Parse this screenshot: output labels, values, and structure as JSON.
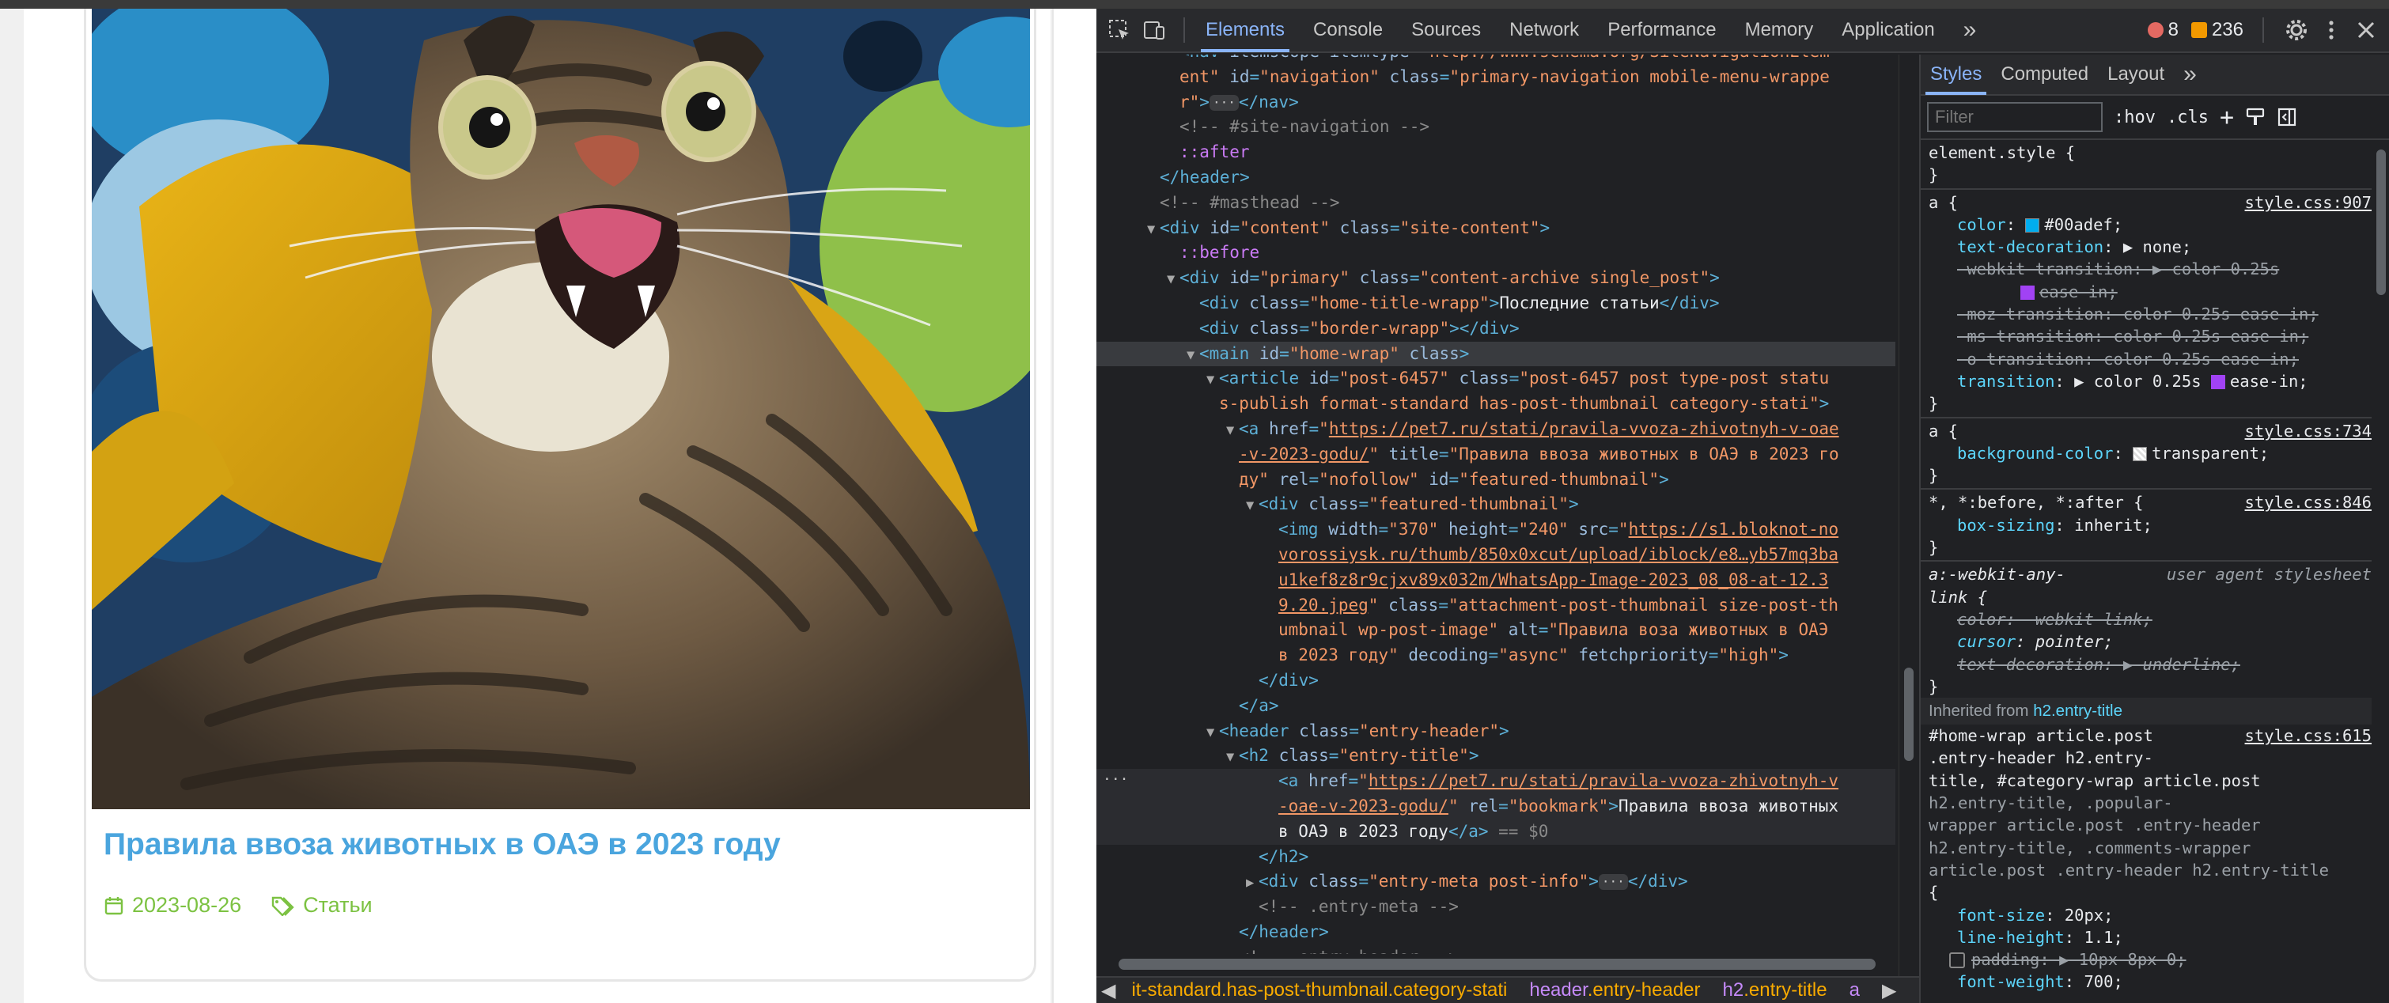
{
  "page": {
    "article_title": "Правила ввоза животных в ОАЭ в 2023 году",
    "date": "2023-08-26",
    "category": "Статьи"
  },
  "devtools": {
    "tabs": [
      "Elements",
      "Console",
      "Sources",
      "Network",
      "Performance",
      "Memory",
      "Application"
    ],
    "more": "»",
    "errors": "8",
    "warnings": "236",
    "styles_tabs": [
      "Styles",
      "Computed",
      "Layout"
    ],
    "filter_placeholder": "Filter",
    "hov": ":hov",
    "cls": ".cls",
    "dom": [
      {
        "i": 3,
        "parts": [
          [
            "tag",
            "<nav "
          ],
          [
            "an",
            "itemscope itemtype"
          ],
          [
            "tag",
            "="
          ],
          [
            "av",
            "\"http://www.schema.org/SiteNavigationElem"
          ]
        ]
      },
      {
        "i": 3,
        "parts": [
          [
            "av",
            "ent\" "
          ],
          [
            "an",
            "id"
          ],
          [
            "tag",
            "="
          ],
          [
            "av",
            "\"navigation\" "
          ],
          [
            "an",
            "class"
          ],
          [
            "tag",
            "="
          ],
          [
            "av",
            "\"primary-navigation mobile-menu-wrappe"
          ]
        ]
      },
      {
        "i": 3,
        "parts": [
          [
            "av",
            "r\""
          ],
          [
            "tag",
            ">"
          ],
          [
            "ell",
            "···"
          ],
          [
            "tag",
            "</nav>"
          ]
        ]
      },
      {
        "i": 3,
        "parts": [
          [
            "cm",
            "<!-- #site-navigation -->"
          ]
        ]
      },
      {
        "i": 3,
        "parts": [
          [
            "pe",
            "::after"
          ]
        ]
      },
      {
        "i": 2,
        "parts": [
          [
            "tag",
            "</header>"
          ]
        ]
      },
      {
        "i": 2,
        "parts": [
          [
            "cm",
            "<!-- #masthead -->"
          ]
        ]
      },
      {
        "i": 2,
        "tri": "▼",
        "parts": [
          [
            "tag",
            "<div "
          ],
          [
            "an",
            "id"
          ],
          [
            "tag",
            "="
          ],
          [
            "av",
            "\"content\" "
          ],
          [
            "an",
            "class"
          ],
          [
            "tag",
            "="
          ],
          [
            "av",
            "\"site-content\""
          ],
          [
            "tag",
            ">"
          ]
        ]
      },
      {
        "i": 3,
        "parts": [
          [
            "pe",
            "::before"
          ]
        ]
      },
      {
        "i": 3,
        "tri": "▼",
        "parts": [
          [
            "tag",
            "<div "
          ],
          [
            "an",
            "id"
          ],
          [
            "tag",
            "="
          ],
          [
            "av",
            "\"primary\" "
          ],
          [
            "an",
            "class"
          ],
          [
            "tag",
            "="
          ],
          [
            "av",
            "\"content-archive single_post\""
          ],
          [
            "tag",
            ">"
          ]
        ]
      },
      {
        "i": 4,
        "parts": [
          [
            "tag",
            "<div "
          ],
          [
            "an",
            "class"
          ],
          [
            "tag",
            "="
          ],
          [
            "av",
            "\"home-title-wrapp\""
          ],
          [
            "tag",
            ">"
          ],
          [
            "tx",
            "Последние статьи"
          ],
          [
            "tag",
            "</div>"
          ]
        ]
      },
      {
        "i": 4,
        "parts": [
          [
            "tag",
            "<div "
          ],
          [
            "an",
            "class"
          ],
          [
            "tag",
            "="
          ],
          [
            "av",
            "\"border-wrapp\""
          ],
          [
            "tag",
            "></div>"
          ]
        ]
      },
      {
        "i": 4,
        "tri": "▼",
        "sel": true,
        "parts": [
          [
            "tag",
            "<main "
          ],
          [
            "an",
            "id"
          ],
          [
            "tag",
            "="
          ],
          [
            "av",
            "\"home-wrap\" "
          ],
          [
            "an",
            "class"
          ],
          [
            "tag",
            ">"
          ]
        ]
      },
      {
        "i": 5,
        "tri": "▼",
        "parts": [
          [
            "tag",
            "<article "
          ],
          [
            "an",
            "id"
          ],
          [
            "tag",
            "="
          ],
          [
            "av",
            "\"post-6457\" "
          ],
          [
            "an",
            "class"
          ],
          [
            "tag",
            "="
          ],
          [
            "av",
            "\"post-6457 post type-post statu"
          ]
        ]
      },
      {
        "i": 5,
        "parts": [
          [
            "av",
            "s-publish format-standard has-post-thumbnail category-stati\""
          ],
          [
            "tag",
            ">"
          ]
        ]
      },
      {
        "i": 6,
        "tri": "▼",
        "parts": [
          [
            "tag",
            "<a "
          ],
          [
            "an",
            "href"
          ],
          [
            "tag",
            "="
          ],
          [
            "av",
            "\""
          ],
          [
            "lk",
            "https://pet7.ru/stati/pravila-vvoza-zhivotnyh-v-oae"
          ]
        ]
      },
      {
        "i": 6,
        "parts": [
          [
            "lk",
            "-v-2023-godu/"
          ],
          [
            "av",
            "\" "
          ],
          [
            "an",
            "title"
          ],
          [
            "tag",
            "="
          ],
          [
            "av",
            "\"Правила ввоза животных в ОАЭ в 2023 го"
          ]
        ]
      },
      {
        "i": 6,
        "parts": [
          [
            "av",
            "ду\" "
          ],
          [
            "an",
            "rel"
          ],
          [
            "tag",
            "="
          ],
          [
            "av",
            "\"nofollow\" "
          ],
          [
            "an",
            "id"
          ],
          [
            "tag",
            "="
          ],
          [
            "av",
            "\"featured-thumbnail\""
          ],
          [
            "tag",
            ">"
          ]
        ]
      },
      {
        "i": 7,
        "tri": "▼",
        "parts": [
          [
            "tag",
            "<div "
          ],
          [
            "an",
            "class"
          ],
          [
            "tag",
            "="
          ],
          [
            "av",
            "\"featured-thumbnail\""
          ],
          [
            "tag",
            ">"
          ]
        ]
      },
      {
        "i": 8,
        "parts": [
          [
            "tag",
            "<img "
          ],
          [
            "an",
            "width"
          ],
          [
            "tag",
            "="
          ],
          [
            "av",
            "\"370\" "
          ],
          [
            "an",
            "height"
          ],
          [
            "tag",
            "="
          ],
          [
            "av",
            "\"240\" "
          ],
          [
            "an",
            "src"
          ],
          [
            "tag",
            "="
          ],
          [
            "av",
            "\""
          ],
          [
            "lk",
            "https://s1.bloknot-no"
          ]
        ]
      },
      {
        "i": 8,
        "parts": [
          [
            "lk",
            "vorossiysk.ru/thumb/850x0xcut/upload/iblock/e8…yb57mq3ba"
          ]
        ]
      },
      {
        "i": 8,
        "parts": [
          [
            "lk",
            "u1kef8z8r9cjxv89x032m/WhatsApp-Image-2023_08_08-at-12.3"
          ]
        ]
      },
      {
        "i": 8,
        "parts": [
          [
            "lk",
            "9.20.jpeg"
          ],
          [
            "av",
            "\" "
          ],
          [
            "an",
            "class"
          ],
          [
            "tag",
            "="
          ],
          [
            "av",
            "\"attachment-post-thumbnail size-post-th"
          ]
        ]
      },
      {
        "i": 8,
        "parts": [
          [
            "av",
            "umbnail wp-post-image\" "
          ],
          [
            "an",
            "alt"
          ],
          [
            "tag",
            "="
          ],
          [
            "av",
            "\"Правила воза животных в ОАЭ"
          ]
        ]
      },
      {
        "i": 8,
        "parts": [
          [
            "av",
            "в 2023 году\" "
          ],
          [
            "an",
            "decoding"
          ],
          [
            "tag",
            "="
          ],
          [
            "av",
            "\"async\" "
          ],
          [
            "an",
            "fetchpriority"
          ],
          [
            "tag",
            "="
          ],
          [
            "av",
            "\"high\""
          ],
          [
            "tag",
            ">"
          ]
        ]
      },
      {
        "i": 7,
        "parts": [
          [
            "tag",
            "</div>"
          ]
        ]
      },
      {
        "i": 6,
        "parts": [
          [
            "tag",
            "</a>"
          ]
        ]
      },
      {
        "i": 5,
        "tri": "▼",
        "parts": [
          [
            "tag",
            "<header "
          ],
          [
            "an",
            "class"
          ],
          [
            "tag",
            "="
          ],
          [
            "av",
            "\"entry-header\""
          ],
          [
            "tag",
            ">"
          ]
        ]
      },
      {
        "i": 6,
        "tri": "▼",
        "parts": [
          [
            "tag",
            "<h2 "
          ],
          [
            "an",
            "class"
          ],
          [
            "tag",
            "="
          ],
          [
            "av",
            "\"entry-title\""
          ],
          [
            "tag",
            ">"
          ]
        ]
      },
      {
        "i": 8,
        "hov": true,
        "parts": [
          [
            "tag",
            "<a "
          ],
          [
            "an",
            "href"
          ],
          [
            "tag",
            "="
          ],
          [
            "av",
            "\""
          ],
          [
            "lk",
            "https://pet7.ru/stati/pravila-vvoza-zhivotnyh-v"
          ]
        ]
      },
      {
        "i": 8,
        "hov": true,
        "parts": [
          [
            "lk",
            "-oae-v-2023-godu/"
          ],
          [
            "av",
            "\" "
          ],
          [
            "an",
            "rel"
          ],
          [
            "tag",
            "="
          ],
          [
            "av",
            "\"bookmark\""
          ],
          [
            "tag",
            ">"
          ],
          [
            "tx",
            "Правила ввоза животных"
          ]
        ]
      },
      {
        "i": 8,
        "hov": true,
        "parts": [
          [
            "tx",
            "в ОАЭ в 2023 году"
          ],
          [
            "tag",
            "</a>"
          ],
          [
            "cm",
            " == $0"
          ]
        ]
      },
      {
        "i": 7,
        "parts": [
          [
            "tag",
            "</h2>"
          ]
        ]
      },
      {
        "i": 7,
        "tri": "▶",
        "parts": [
          [
            "tag",
            "<div "
          ],
          [
            "an",
            "class"
          ],
          [
            "tag",
            "="
          ],
          [
            "av",
            "\"entry-meta post-info\""
          ],
          [
            "tag",
            ">"
          ],
          [
            "ell",
            "···"
          ],
          [
            "tag",
            "</div>"
          ]
        ]
      },
      {
        "i": 7,
        "parts": [
          [
            "cm",
            "<!-- .entry-meta -->"
          ]
        ]
      },
      {
        "i": 6,
        "parts": [
          [
            "tag",
            "</header>"
          ]
        ]
      },
      {
        "i": 6,
        "parts": [
          [
            "cm",
            "<!-- .entry-header -->"
          ]
        ]
      }
    ],
    "breadcrumbs": [
      {
        "kind": "cls",
        "text": "it-standard.has-post-thumbnail.category-stati"
      },
      {
        "kind": "tag",
        "text": "header",
        "cls": ".entry-header"
      },
      {
        "kind": "tag",
        "text": "h2",
        "cls": ".entry-title"
      },
      {
        "kind": "tag",
        "text": "a",
        "cls": ""
      }
    ],
    "styles": {
      "element_style": "element.style {",
      "close": "}",
      "rule_a1": {
        "sel": "a {",
        "src": "style.css:907"
      },
      "color_prop": "color",
      "color_val": "#00adef",
      "color_swatch": "#00adef",
      "td_prop": "text-decoration",
      "td_val": "none;",
      "webkit_tr": "-webkit-transition: ▶ color 0.25s",
      "webkit_tr2": "ease-in;",
      "moz_tr": "-moz-transition: color 0.25s ease-in;",
      "ms_tr": "-ms-transition: color 0.25s ease-in;",
      "o_tr": "-o-transition: color 0.25s ease-in;",
      "tr_prop": "transition",
      "tr_val": "▶ color 0.25s",
      "tr_val2": "ease-in;",
      "rule_a2": {
        "sel": "a {",
        "src": "style.css:734"
      },
      "bg_prop": "background-color",
      "bg_val": "transparent;",
      "rule_star": {
        "sel": "*, *:before, *:after {",
        "src": "style.css:846"
      },
      "bs_prop": "box-sizing",
      "bs_val": "inherit;",
      "ua_sel": "a:-webkit-any-",
      "ua_sel2": "link {",
      "ua_label": "user agent stylesheet",
      "ua_color": "color: -webkit-link;",
      "ua_cursor_prop": "cursor",
      "ua_cursor_val": "pointer;",
      "ua_td": "text-decoration: ▶ underline;",
      "inherited_label": "Inherited from",
      "inherited_el": "h2.entry-title",
      "rule_inh": {
        "src": "style.css:615"
      },
      "inh_sel": [
        "#home-wrap article.post",
        ".entry-header h2.entry-",
        "title, #category-wrap article.post",
        "h2.entry-title, .popular-",
        "wrapper article.post .entry-header",
        "h2.entry-title, .comments-wrapper",
        "article.post .entry-header h2.entry-title",
        "{"
      ],
      "fs_prop": "font-size",
      "fs_val": "20px;",
      "lh_prop": "line-height",
      "lh_val": "1.1;",
      "pad": "padding: ▶ 10px 8px 0;",
      "fw_prop": "font-weight",
      "fw_val": "700;"
    }
  },
  "colors": {
    "title": "#4aa5de",
    "meta": "#7cc242",
    "devtools_bg": "#202124"
  }
}
